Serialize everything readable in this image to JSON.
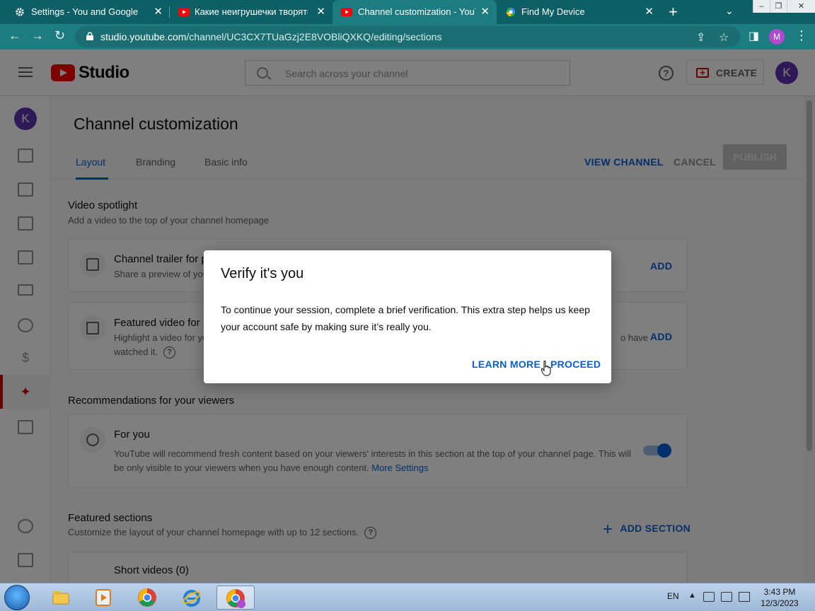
{
  "browser": {
    "tabs": [
      {
        "title": "Settings - You and Google",
        "icon": "gear-icon"
      },
      {
        "title": "Какие неигрушечки творятся(",
        "icon": "youtube-icon"
      },
      {
        "title": "Channel customization - YouTub",
        "icon": "youtube-icon",
        "active": true
      },
      {
        "title": "Find My Device",
        "icon": "find-my-device-icon"
      }
    ],
    "url_host": "studio.youtube.com",
    "url_path": "/channel/UC3CX7TUaGzj2E8VOBliQXKQ/editing/sections",
    "profile_initial": "M"
  },
  "header": {
    "studio_label": "Studio",
    "search_placeholder": "Search across your channel",
    "help_glyph": "?",
    "create_label": "CREATE",
    "avatar_initial": "K"
  },
  "nav": {
    "avatar_initial": "K",
    "items": [
      "dashboard-icon",
      "content-icon",
      "analytics-icon",
      "comments-icon",
      "subtitles-icon",
      "copyright-icon",
      "earn-icon",
      "customization-icon",
      "audio-library-icon",
      "settings-icon",
      "feedback-icon"
    ]
  },
  "page": {
    "title": "Channel customization",
    "tabs": [
      "Layout",
      "Branding",
      "Basic info"
    ],
    "view_channel": "VIEW CHANNEL",
    "cancel": "CANCEL",
    "publish": "PUBLISH"
  },
  "spotlight": {
    "title": "Video spotlight",
    "desc": "Add a video to the top of your channel homepage",
    "trailer_title": "Channel trailer for p",
    "trailer_text": "Share a preview of you",
    "featured_title": "Featured video for",
    "featured_text_1": "Highlight a video for yo",
    "featured_text_tail": "o have",
    "featured_text_2": "watched it.",
    "add": "ADD"
  },
  "recommendations": {
    "title": "Recommendations for your viewers",
    "card_title": "For you",
    "card_text_1": "YouTube will recommend fresh content based on your viewers' interests in this section at the top of your channel page. This will",
    "card_text_2": "be only visible to your viewers when you have enough content.",
    "more_settings": "More Settings",
    "toggle_on": true
  },
  "featured_sections": {
    "title": "Featured sections",
    "desc": "Customize the layout of your channel homepage with up to 12 sections.",
    "add_section": "ADD SECTION",
    "first_section": "Short videos (0)"
  },
  "dialog": {
    "title": "Verify it's you",
    "body": "To continue your session, complete a brief verification. This extra step helps us keep your account safe by making sure it’s really you.",
    "learn_more": "LEARN MORE",
    "proceed": "PROCEED"
  },
  "taskbar": {
    "lang": "EN",
    "time": "3:43 PM",
    "date": "12/3/2023",
    "apps": [
      "explorer-icon",
      "media-player-icon",
      "chrome-icon",
      "internet-explorer-icon",
      "chrome-profile-icon"
    ]
  }
}
